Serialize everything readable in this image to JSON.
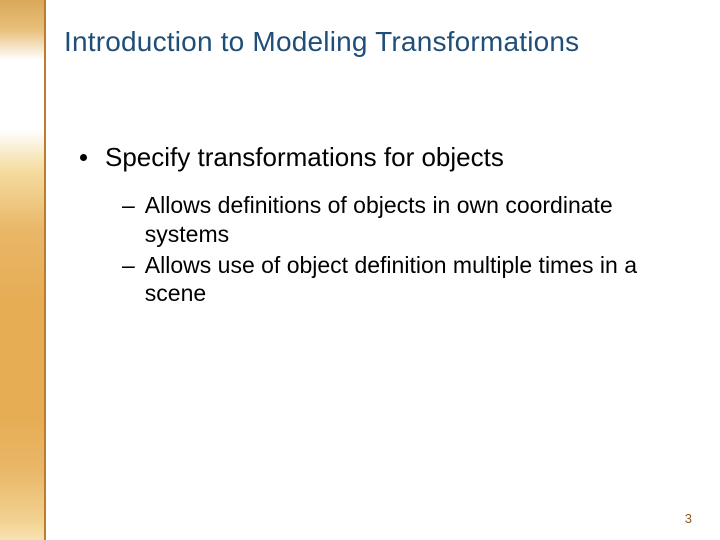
{
  "title": "Introduction to Modeling Transformations",
  "bullets": {
    "main": "Specify transformations for objects",
    "subs": [
      "Allows definitions of objects in own coordinate systems",
      "Allows use of object definition multiple times in a scene"
    ]
  },
  "page_number": "3"
}
